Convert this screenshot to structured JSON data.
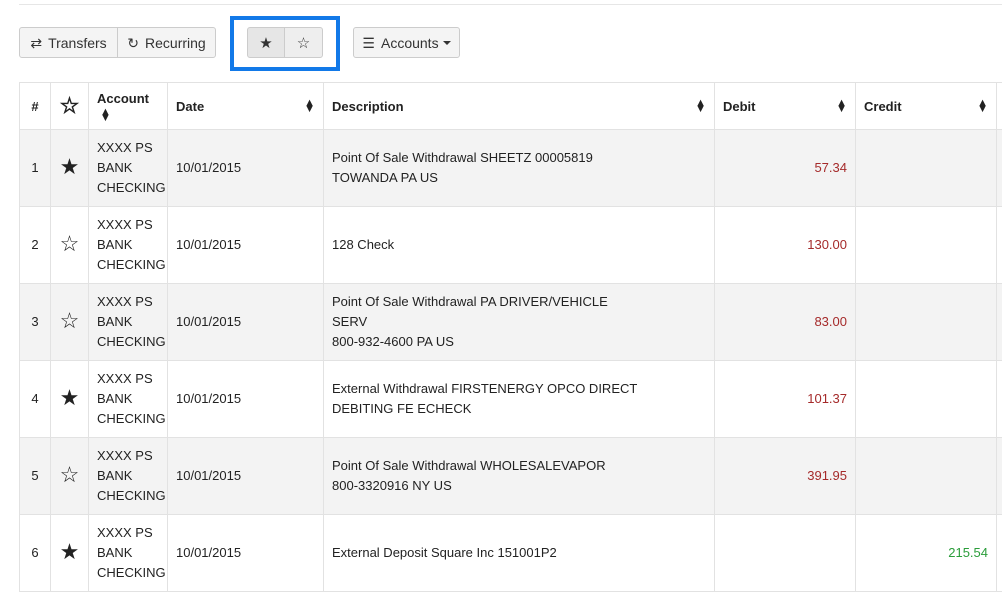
{
  "toolbar": {
    "transfers_label": "Transfers",
    "recurring_label": "Recurring",
    "accounts_label": "Accounts"
  },
  "icons": {
    "transfers": "exchange-icon",
    "recurring": "refresh-icon",
    "accounts": "bars-icon",
    "star_filled": "star-filled-icon",
    "star_empty": "star-empty-icon"
  },
  "colors": {
    "debit": "#a52a2a",
    "credit": "#2a9d3a",
    "focus": "#1279e8"
  },
  "table": {
    "headers": {
      "num": "#",
      "account": "Account",
      "date": "Date",
      "description": "Description",
      "debit": "Debit",
      "credit": "Credit"
    },
    "rows": [
      {
        "num": "1",
        "starred": true,
        "account": [
          "XXXX PS",
          "BANK",
          "CHECKING"
        ],
        "date": "10/01/2015",
        "description": [
          "Point Of Sale Withdrawal SHEETZ 00005819",
          "TOWANDA PA US"
        ],
        "debit": "57.34",
        "credit": ""
      },
      {
        "num": "2",
        "starred": false,
        "account": [
          "XXXX PS",
          "BANK",
          "CHECKING"
        ],
        "date": "10/01/2015",
        "description": [
          "128 Check"
        ],
        "debit": "130.00",
        "credit": ""
      },
      {
        "num": "3",
        "starred": false,
        "account": [
          "XXXX PS",
          "BANK",
          "CHECKING"
        ],
        "date": "10/01/2015",
        "description": [
          "Point Of Sale Withdrawal PA DRIVER/VEHICLE",
          "SERV",
          "800-932-4600 PA US"
        ],
        "debit": "83.00",
        "credit": ""
      },
      {
        "num": "4",
        "starred": true,
        "account": [
          "XXXX PS",
          "BANK",
          "CHECKING"
        ],
        "date": "10/01/2015",
        "description": [
          "External Withdrawal FIRSTENERGY OPCO DIRECT",
          "DEBITING FE ECHECK"
        ],
        "debit": "101.37",
        "credit": ""
      },
      {
        "num": "5",
        "starred": false,
        "account": [
          "XXXX PS",
          "BANK",
          "CHECKING"
        ],
        "date": "10/01/2015",
        "description": [
          "Point Of Sale Withdrawal WHOLESALEVAPOR",
          "800-3320916 NY US"
        ],
        "debit": "391.95",
        "credit": ""
      },
      {
        "num": "6",
        "starred": true,
        "account": [
          "XXXX PS",
          "BANK",
          "CHECKING"
        ],
        "date": "10/01/2015",
        "description": [
          "External Deposit Square Inc 151001P2"
        ],
        "debit": "",
        "credit": "215.54"
      }
    ]
  }
}
